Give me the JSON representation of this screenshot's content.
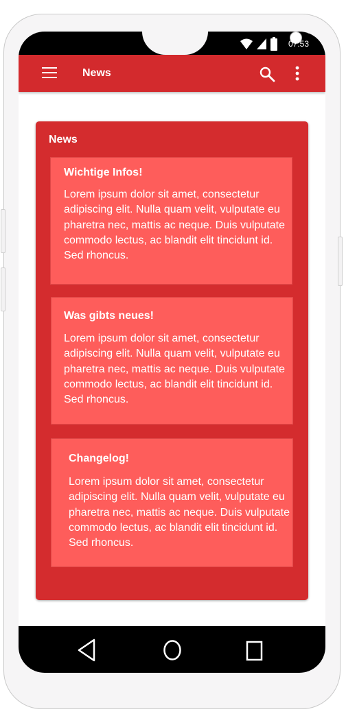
{
  "status_bar": {
    "time": "07:53",
    "icons": [
      "wifi-icon",
      "signal-icon",
      "battery-icon"
    ]
  },
  "app_bar": {
    "title": "News",
    "icons": [
      "menu-icon",
      "search-icon",
      "more-vert-icon"
    ]
  },
  "news": {
    "title": "News",
    "items": [
      {
        "heading": "Wichtige Infos!",
        "body": "Lorem ipsum dolor sit amet, consectetur adipiscing elit. Nulla quam velit, vulputate eu pharetra nec, mattis ac neque. Duis vulputate commodo lectus, ac blandit elit tincidunt id. Sed rhoncus."
      },
      {
        "heading": "Was gibts neues!",
        "body": "Lorem ipsum dolor sit amet, consectetur adipiscing elit. Nulla quam velit, vulputate eu pharetra nec, mattis ac neque. Duis vulputate commodo lectus, ac blandit elit tincidunt id. Sed rhoncus."
      },
      {
        "heading": "Changelog!",
        "body": "Lorem ipsum dolor sit amet, consectetur adipiscing elit. Nulla quam velit, vulputate eu pharetra nec, mattis ac neque. Duis vulputate commodo lectus, ac blandit elit tincidunt id. Sed rhoncus."
      }
    ]
  },
  "nav_bar": {
    "icons": [
      "back-icon",
      "home-icon",
      "recent-apps-icon"
    ]
  },
  "colors": {
    "primary": "#d32a2d",
    "card": "#fe5d5b",
    "text": "#ffffff"
  }
}
